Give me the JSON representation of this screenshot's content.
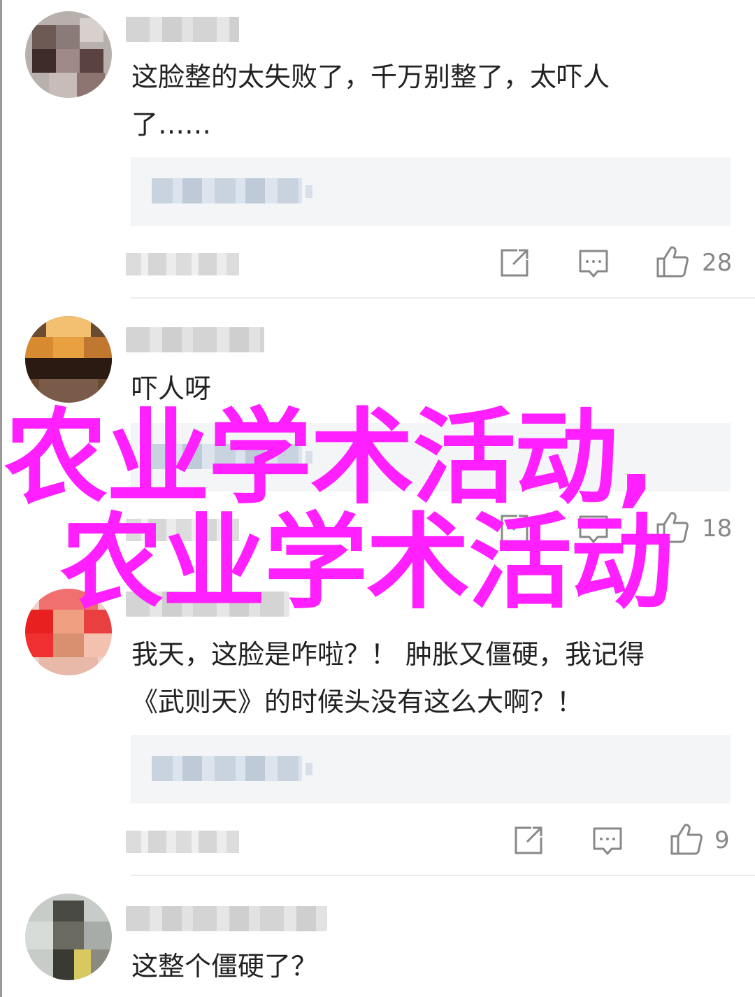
{
  "comments": [
    {
      "text": "这脸整的太失败了，千万别整了，太吓人\n了……",
      "likes": "28"
    },
    {
      "text": "吓人呀",
      "likes": "18"
    },
    {
      "text": "我天，这脸是咋啦？！ 肿胀又僵硬，我记得\n《武则天》的时候头没有这么大啊？！",
      "likes": "9"
    },
    {
      "text": "这整个僵硬了？"
    }
  ],
  "watermark": {
    "line1": "农业学术活动,",
    "line2": "农业学术活动"
  },
  "icons": {
    "share": "share-icon",
    "reply": "reply-icon",
    "like": "thumbs-up-icon"
  },
  "colors": {
    "watermark": "#ff1fff",
    "icon": "#888888"
  }
}
